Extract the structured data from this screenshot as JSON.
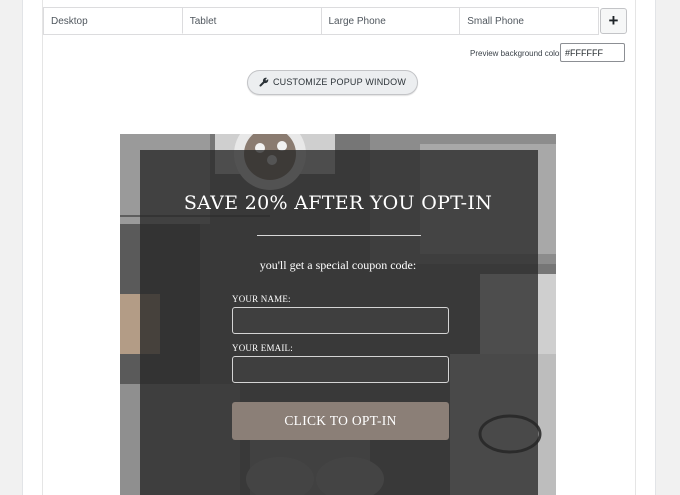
{
  "device_tabs": [
    {
      "label": "Desktop"
    },
    {
      "label": "Tablet"
    },
    {
      "label": "Large Phone"
    },
    {
      "label": "Small Phone"
    }
  ],
  "add_button": {
    "label": "+"
  },
  "preview_background": {
    "label": "Preview background color",
    "value": "#FFFFFF"
  },
  "customize_button": {
    "label": "CUSTOMIZE POPUP WINDOW",
    "icon": "wrench-icon"
  },
  "popup": {
    "title": "SAVE 20% AFTER YOU OPT-IN",
    "subtitle": "you'll get a special coupon code:",
    "name_label": "YOUR NAME:",
    "email_label": "YOUR EMAIL:",
    "submit_label": "CLICK TO OPT-IN",
    "button_color": "#8b7f77",
    "overlay_color": "#282828"
  },
  "colors": {
    "page_background": "#f1f1f1",
    "panel_background": "#ffffff"
  }
}
